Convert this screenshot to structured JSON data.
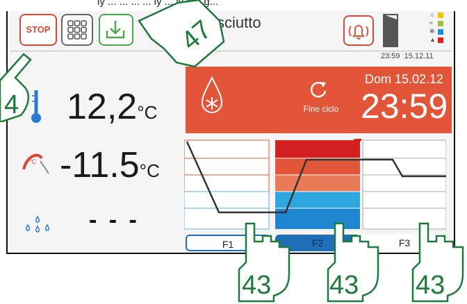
{
  "topbar_fragment": "ly ...   ...   ...   ... ly ... ly p... g...",
  "toolbar": {
    "stop_label": "STOP",
    "title": "sciutto",
    "status_time": "23:59",
    "status_date": "15.12.11"
  },
  "legend_colors": [
    "#f2c200",
    "#9dc243",
    "#1e90d6",
    "#e02020"
  ],
  "banner": {
    "cycle_label": "Fine ciclo",
    "day_date": "Dom 15.02.12",
    "time": "23:59",
    "background": "#e25538"
  },
  "readings": {
    "chamber_temp": "12,2",
    "chamber_unit": "°C",
    "probe_temp": "-11.5",
    "probe_unit": "°C",
    "humidity": "- - -"
  },
  "phases": {
    "labels": [
      "F1",
      "F2",
      "F3"
    ],
    "active_index": 1
  },
  "overlay_labels": {
    "hand_top_left": "4",
    "hand_top": "47",
    "hand_bottom": [
      "43",
      "43",
      "43"
    ]
  }
}
